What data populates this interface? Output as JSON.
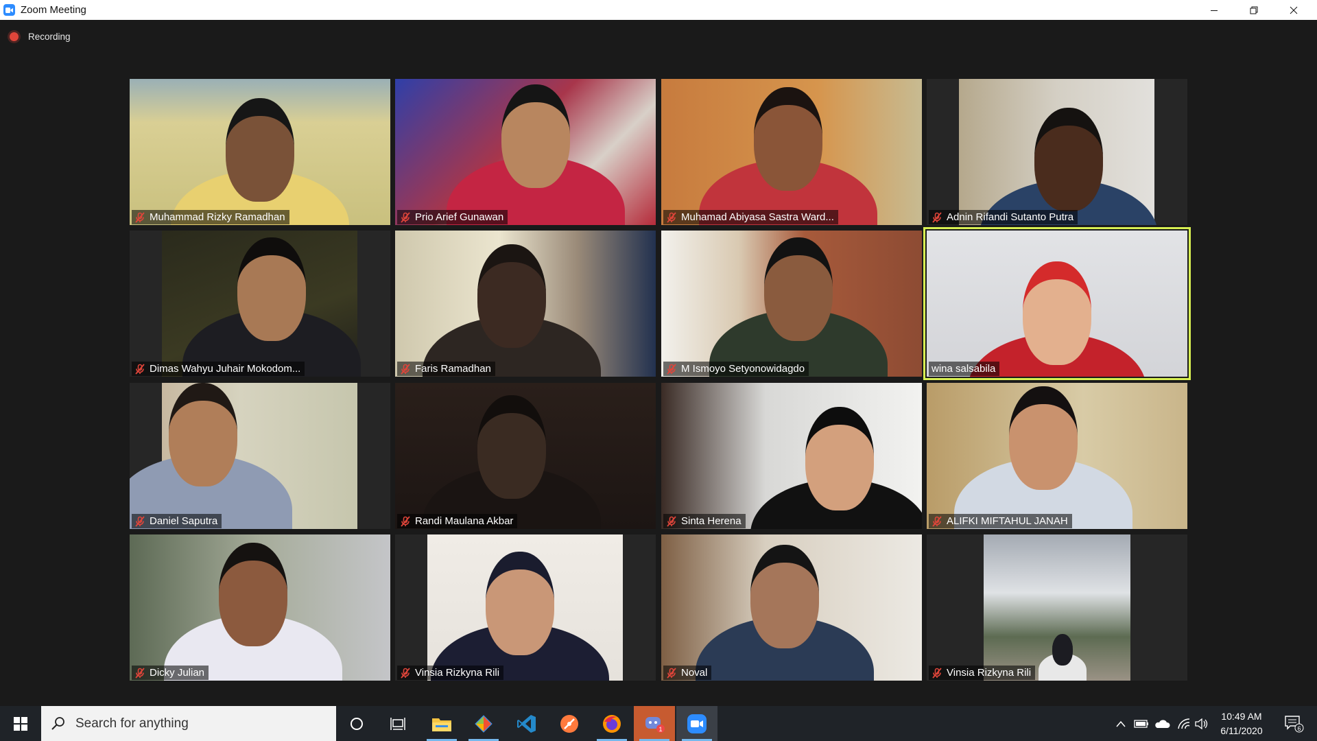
{
  "window": {
    "title": "Zoom Meeting",
    "minimize_icon": "minimize-icon",
    "restore_icon": "restore-icon",
    "close_icon": "close-icon"
  },
  "meeting": {
    "recording_label": "Recording",
    "active_speaker_color": "#d7ef52"
  },
  "participants": [
    {
      "name": "Muhammad Rizky Ramadhan",
      "muted": true
    },
    {
      "name": "Prio Arief Gunawan",
      "muted": true
    },
    {
      "name": "Muhamad Abiyasa Sastra Ward...",
      "muted": true
    },
    {
      "name": "Adnin Rifandi Sutanto Putra",
      "muted": true
    },
    {
      "name": "Dimas Wahyu Juhair Mokodom...",
      "muted": true
    },
    {
      "name": "Faris Ramadhan",
      "muted": true
    },
    {
      "name": "M Ismoyo Setyonowidagdo",
      "muted": true
    },
    {
      "name": "wina salsabila",
      "muted": false
    },
    {
      "name": "Daniel Saputra",
      "muted": true
    },
    {
      "name": "Randi Maulana Akbar",
      "muted": true
    },
    {
      "name": "Sinta Herena",
      "muted": true
    },
    {
      "name": "ALIFKI MIFTAHUL JANAH",
      "muted": true
    },
    {
      "name": "Dicky Julian",
      "muted": true
    },
    {
      "name": "Vinsia Rizkyna Rili",
      "muted": true
    },
    {
      "name": "Noval",
      "muted": true
    },
    {
      "name": "Vinsia Rizkyna Rili",
      "muted": true
    }
  ],
  "taskbar": {
    "search_placeholder": "Search for anything",
    "apps": [
      "windows-start-icon",
      "cortana-icon",
      "task-view-icon",
      "file-explorer-icon",
      "git-icon",
      "vscode-icon",
      "brave-icon",
      "firefox-icon",
      "discord-icon",
      "zoom-icon"
    ],
    "discord_badge": "1",
    "time": "10:49 AM",
    "date": "6/11/2020",
    "notification_count": "6"
  }
}
